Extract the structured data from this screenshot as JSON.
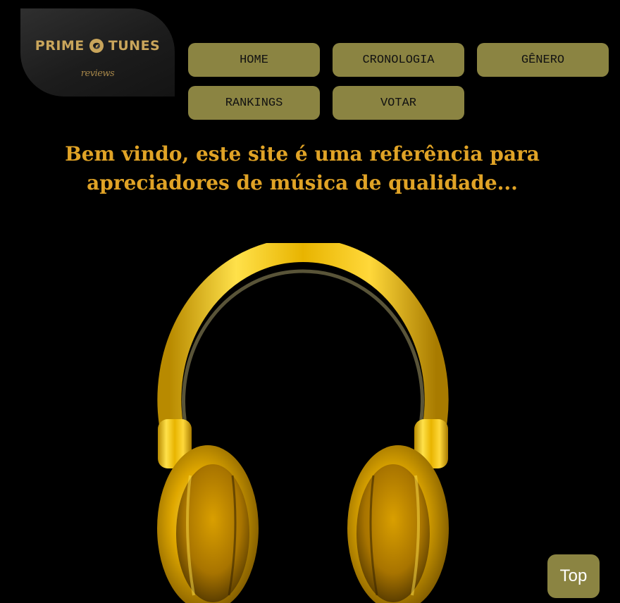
{
  "logo": {
    "brand_left": "PRIME",
    "brand_right": "TUNES",
    "tagline": "reviews",
    "mark_icon": "swirl-logo-icon"
  },
  "nav": {
    "items": [
      {
        "label": "HOME"
      },
      {
        "label": "CRONOLOGIA"
      },
      {
        "label": "GÊNERO"
      },
      {
        "label": "RANKINGS"
      },
      {
        "label": "VOTAR"
      }
    ]
  },
  "hero": {
    "line1": "Bem vindo, este site é uma referência para",
    "line2": "apreciadores de música de qualidade...",
    "image_icon": "gold-headphones-image"
  },
  "top_button": {
    "label": "Top"
  },
  "colors": {
    "background": "#000000",
    "button": "#8b8442",
    "heading": "#e0a326",
    "logo_gold": "#c9a55b"
  }
}
